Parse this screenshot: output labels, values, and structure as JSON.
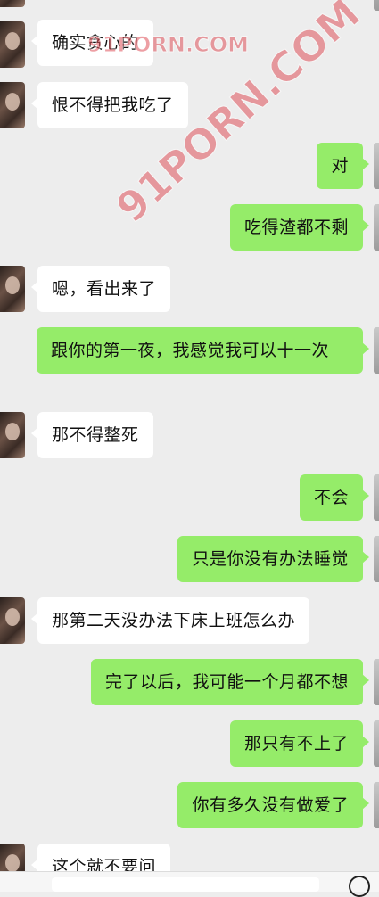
{
  "messages": [
    {
      "side": "in",
      "text": "确实贪心的"
    },
    {
      "side": "in",
      "text": "恨不得把我吃了"
    },
    {
      "side": "out",
      "text": "对"
    },
    {
      "side": "out",
      "text": "吃得渣都不剩"
    },
    {
      "side": "in",
      "text": "嗯，看出来了"
    },
    {
      "side": "out",
      "text": "跟你的第一夜，我感觉我可以十一次"
    },
    {
      "side": "in",
      "text": "那不得整死"
    },
    {
      "side": "out",
      "text": "不会"
    },
    {
      "side": "out",
      "text": "只是你没有办法睡觉"
    },
    {
      "side": "in",
      "text": "那第二天没办法下床上班怎么办"
    },
    {
      "side": "out",
      "text": "完了以后，我可能一个月都不想"
    },
    {
      "side": "out",
      "text": "那只有不上了"
    },
    {
      "side": "out",
      "text": "你有多久没有做爱了"
    },
    {
      "side": "in",
      "text": "这个就不要问"
    }
  ],
  "watermarks": [
    "91PORN.COM",
    "91PORN.COM"
  ],
  "colors": {
    "background": "#ededed",
    "incoming": "#ffffff",
    "outgoing": "#95ec69",
    "watermark": "#e0525a"
  }
}
